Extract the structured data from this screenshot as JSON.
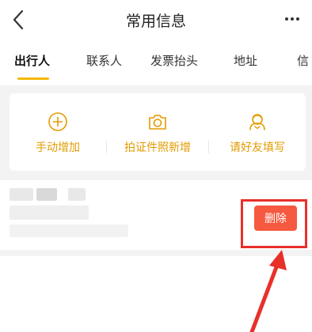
{
  "header": {
    "title": "常用信息",
    "back_icon": "chevron-left-icon",
    "more_icon": "more-horizontal-icon"
  },
  "tabs": [
    {
      "label": "出行人",
      "active": true
    },
    {
      "label": "联系人",
      "active": false
    },
    {
      "label": "发票抬头",
      "active": false
    },
    {
      "label": "地址",
      "active": false
    },
    {
      "label": "信",
      "active": false
    }
  ],
  "actions": [
    {
      "label": "手动增加",
      "icon": "plus-circle-icon"
    },
    {
      "label": "拍证件照新增",
      "icon": "camera-icon"
    },
    {
      "label": "请好友填写",
      "icon": "friend-icon"
    }
  ],
  "traveler_row": {
    "delete_label": "删除"
  },
  "colors": {
    "accent": "#f4b800",
    "action_text": "#e39b00",
    "delete_bg": "#f5593f",
    "highlight_red": "#e8302a"
  }
}
